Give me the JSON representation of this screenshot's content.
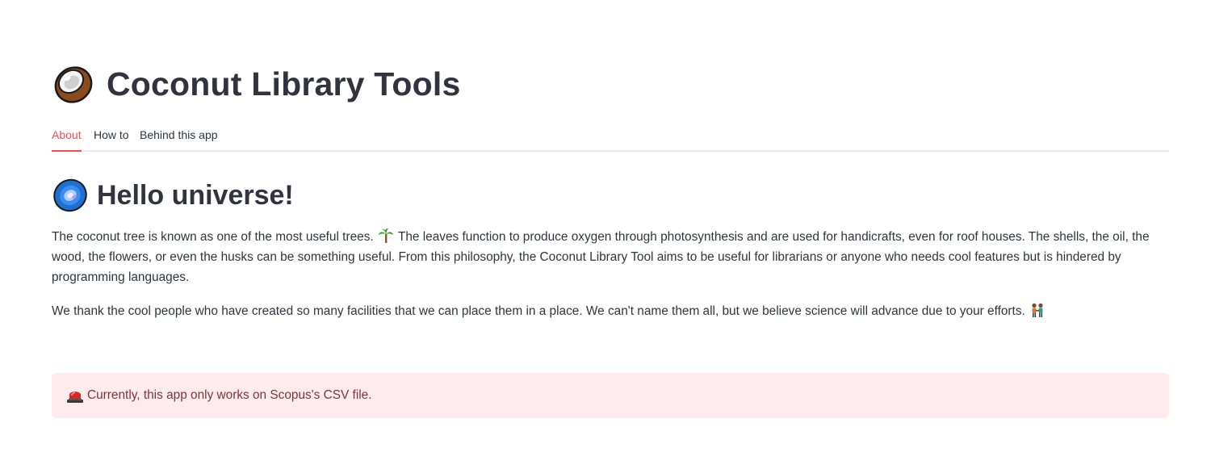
{
  "header": {
    "title": "Coconut Library Tools",
    "icon": "coconut-icon"
  },
  "tabs": [
    {
      "label": "About",
      "active": true
    },
    {
      "label": "How to",
      "active": false
    },
    {
      "label": "Behind this app",
      "active": false
    }
  ],
  "about": {
    "heading": "Hello universe!",
    "heading_icon": "galaxy-icon",
    "paragraph1": {
      "before_icon": "The coconut tree is known as one of the most useful trees.",
      "icon": "palm-tree-icon",
      "after_icon": "The leaves function to produce oxygen through photosynthesis and are used for handicrafts, even for roof houses. The shells, the oil, the wood, the flowers, or even the husks can be something useful. From this philosophy, the Coconut Library Tool aims to be useful for librarians or anyone who needs cool features but is hindered by programming languages."
    },
    "paragraph2": {
      "text": "We thank the cool people who have created so many facilities that we can place them in a place. We can't name them all, but we believe science will advance due to your efforts.",
      "icon": "people-holding-hands-icon"
    }
  },
  "alert": {
    "icon": "siren-icon",
    "text": "Currently, this app only works on Scopus's CSV file."
  },
  "colors": {
    "accent": "#ff4b4b",
    "text": "#31333f",
    "alert_bg": "#ffebee",
    "alert_text": "#7d353b"
  }
}
